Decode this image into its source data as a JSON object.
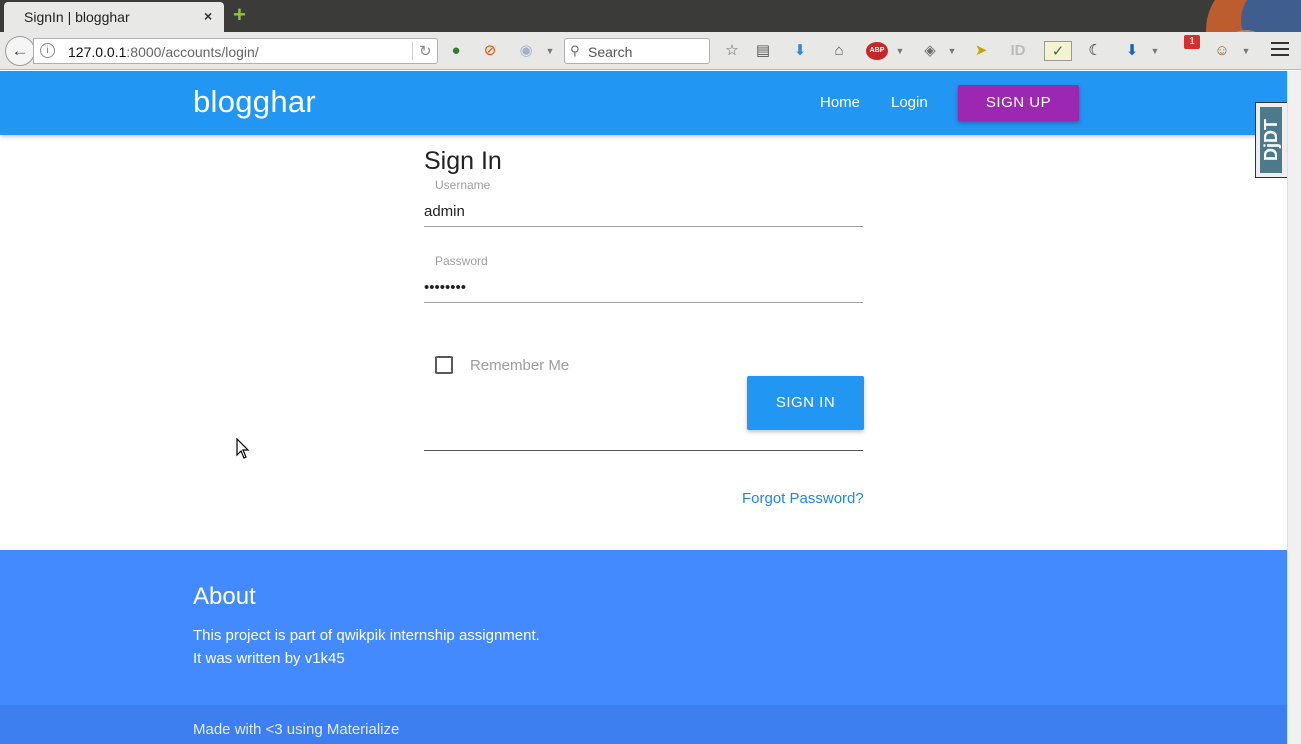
{
  "browser": {
    "tab_title": "SignIn | blogghar",
    "tab_close": "×",
    "new_tab": "+",
    "url_host": "127.0.0.1",
    "url_rest": ":8000/accounts/login/",
    "search_placeholder": "Search",
    "abp_badge": "ABP",
    "notif_count": "1"
  },
  "navbar": {
    "brand": "blogghar",
    "links": [
      "Home",
      "Login"
    ],
    "signup_label": "SIGN UP",
    "brand_color": "#2196f3",
    "signup_color": "#9c27b0"
  },
  "form": {
    "title": "Sign In",
    "username_label": "Username",
    "username_value": "admin",
    "password_label": "Password",
    "password_value": "••••••••",
    "remember_label": "Remember Me",
    "remember_checked": false,
    "submit_label": "SIGN IN",
    "forgot_label": "Forgot Password?"
  },
  "footer": {
    "title": "About",
    "line1": "This project is part of qwikpik internship assignment.",
    "line2": "It was written by v1k45",
    "copyright": "Made with <3 using Materialize",
    "footer_color": "#448aff"
  },
  "debug_toolbar": {
    "label": "DjDT"
  }
}
